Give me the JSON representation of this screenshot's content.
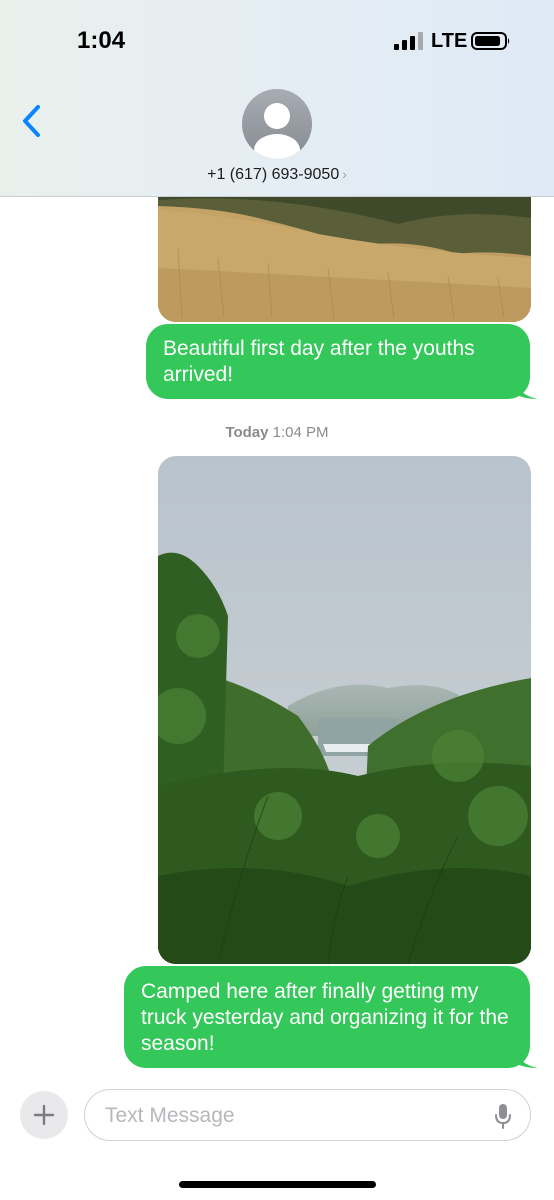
{
  "status_bar": {
    "time": "1:04",
    "network": "LTE"
  },
  "header": {
    "contact": "+1 (617) 693-9050",
    "contact_chevron": "›",
    "icons": [
      "back-chevron-icon",
      "avatar-placeholder-icon"
    ]
  },
  "messages": [
    {
      "type": "image",
      "description_icon": "photo-grassland"
    },
    {
      "type": "text",
      "text": "Beautiful first day after the youths arrived!"
    },
    {
      "type": "timestamp",
      "day": "Today",
      "time": "1:04 PM"
    },
    {
      "type": "image",
      "description_icon": "photo-forest-valley"
    },
    {
      "type": "text",
      "text": "Camped here after finally getting my truck yesterday and organizing it for the season!"
    }
  ],
  "composer": {
    "placeholder": "Text Message",
    "value": "",
    "icons": [
      "plus-icon",
      "microphone-icon"
    ]
  },
  "colors": {
    "bubble": "#34c759",
    "accent": "#0a84ff"
  }
}
